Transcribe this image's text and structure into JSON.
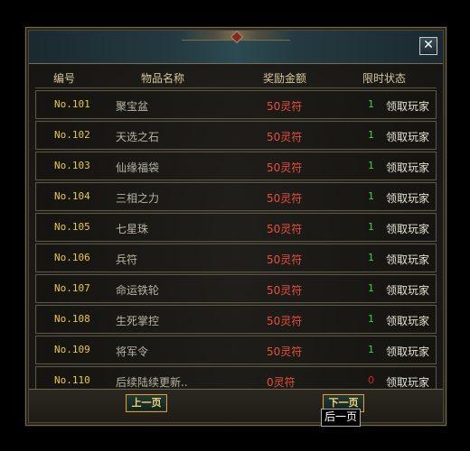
{
  "headers": {
    "number": "编号",
    "item_name": "物品名称",
    "reward": "奖励金额",
    "limit_status": "限时状态"
  },
  "rows": [
    {
      "number": "No.101",
      "name": "聚宝盆",
      "reward": "50灵符",
      "limit": "1",
      "status": "领取玩家"
    },
    {
      "number": "No.102",
      "name": "天选之石",
      "reward": "50灵符",
      "limit": "1",
      "status": "领取玩家"
    },
    {
      "number": "No.103",
      "name": "仙缘福袋",
      "reward": "50灵符",
      "limit": "1",
      "status": "领取玩家"
    },
    {
      "number": "No.104",
      "name": "三相之力",
      "reward": "50灵符",
      "limit": "1",
      "status": "领取玩家"
    },
    {
      "number": "No.105",
      "name": "七星珠",
      "reward": "50灵符",
      "limit": "1",
      "status": "领取玩家"
    },
    {
      "number": "No.106",
      "name": "兵符",
      "reward": "50灵符",
      "limit": "1",
      "status": "领取玩家"
    },
    {
      "number": "No.107",
      "name": "命运铁轮",
      "reward": "50灵符",
      "limit": "1",
      "status": "领取玩家"
    },
    {
      "number": "No.108",
      "name": "生死掌控",
      "reward": "50灵符",
      "limit": "1",
      "status": "领取玩家"
    },
    {
      "number": "No.109",
      "name": "将军令",
      "reward": "50灵符",
      "limit": "1",
      "status": "领取玩家"
    },
    {
      "number": "No.110",
      "name": "后续陆续更新..",
      "reward": "0灵符",
      "limit": "0",
      "status": "领取玩家"
    }
  ],
  "footer": {
    "prev_label": "上一页",
    "next_label": "下一页",
    "tooltip": "后一页"
  },
  "close_label": "✕",
  "colors": {
    "number": "#e8c846",
    "reward": "#e8503a",
    "limit_active": "#3cd24a",
    "limit_zero": "#e02020"
  }
}
